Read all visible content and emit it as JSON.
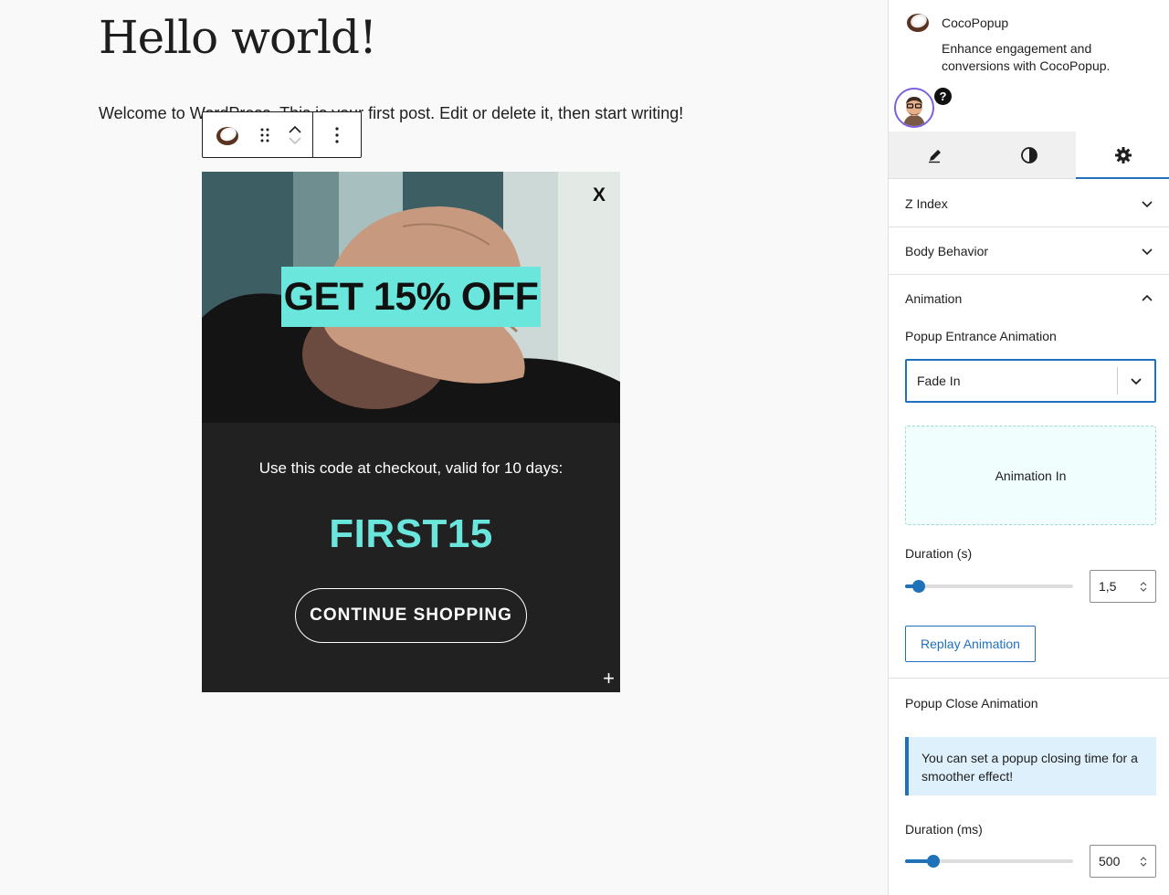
{
  "post": {
    "title": "Hello world!",
    "paragraph": "Welcome to WordPress. This is your first post. Edit or delete it, then start writing!"
  },
  "popup": {
    "close_label": "X",
    "banner": "GET 15% OFF",
    "description": "Use this code at checkout, valid for 10 days:",
    "code": "FIRST15",
    "cta": "CONTINUE SHOPPING",
    "add_label": "+"
  },
  "sidebar": {
    "plugin_name": "CocoPopup",
    "plugin_desc": "Enhance engagement and conversions with CocoPopup.",
    "help_label": "?",
    "tabs": [
      {
        "icon": "pencil-icon"
      },
      {
        "icon": "contrast-icon"
      },
      {
        "icon": "gear-icon",
        "active": true
      }
    ],
    "panels": {
      "z_index": "Z Index",
      "body_behavior": "Body Behavior",
      "animation": "Animation"
    },
    "entrance": {
      "label": "Popup Entrance Animation",
      "selected": "Fade In",
      "preview_text": "Animation In",
      "duration_label": "Duration (s)",
      "duration_value": "1,5",
      "slider_fraction": 0.08,
      "replay_label": "Replay Animation"
    },
    "close": {
      "label": "Popup Close Animation",
      "notice": "You can set a popup closing time for a smoother effect!",
      "duration_label": "Duration (ms)",
      "duration_value": "500",
      "slider_fraction": 0.17
    }
  },
  "colors": {
    "accent": "#1f72b8",
    "popup_teal": "#6ae6dd",
    "popup_bg": "#212121"
  }
}
